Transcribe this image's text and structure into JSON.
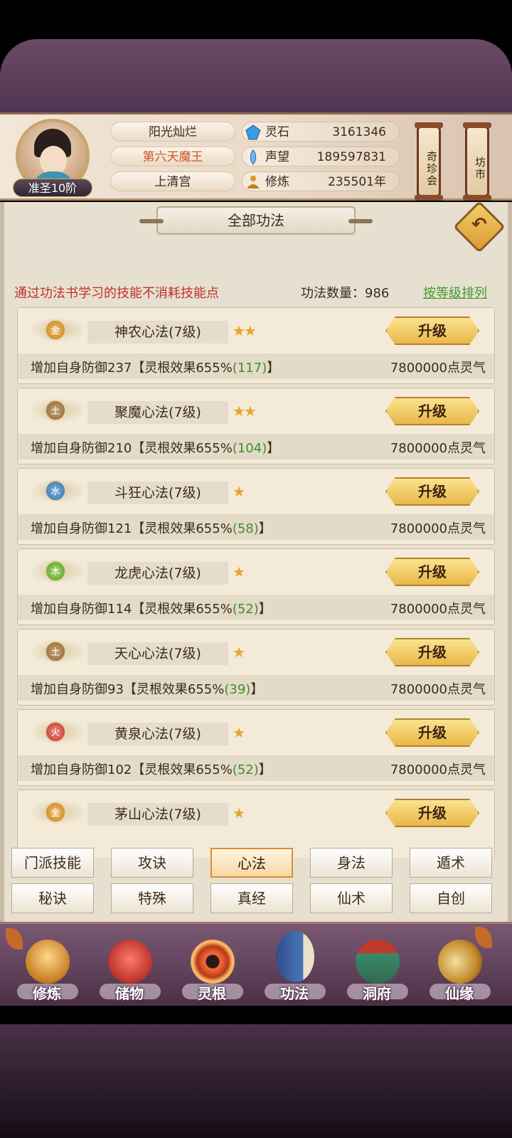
{
  "header": {
    "rank_badge": "准圣10阶",
    "player_name": "阳光灿烂",
    "title": "第六天魔王",
    "sect": "上清宫",
    "resources": [
      {
        "icon": "spirit-stone-icon",
        "label": "灵石",
        "value": "3161346"
      },
      {
        "icon": "prestige-icon",
        "label": "声望",
        "value": "189597831"
      },
      {
        "icon": "cultivation-icon",
        "label": "修炼",
        "value": "235501年"
      }
    ],
    "scroll_buttons": [
      "奇珍会",
      "坊市"
    ]
  },
  "panel": {
    "title": "全部功法",
    "hint": "通过功法书学习的技能不消耗技能点",
    "count_label": "功法数量：986",
    "sort_label": "按等级排列"
  },
  "skills": [
    {
      "element": "金",
      "element_class": "e-gold",
      "name": "神农心法(7级)",
      "stars": "★★",
      "upgrade": "升级",
      "desc_prefix": "增加自身防御237【灵根效果655%",
      "desc_bonus": "(117)",
      "desc_suffix": "】",
      "cost": "7800000点灵气"
    },
    {
      "element": "土",
      "element_class": "e-earth",
      "name": "聚魔心法(7级)",
      "stars": "★★",
      "upgrade": "升级",
      "desc_prefix": "增加自身防御210【灵根效果655%",
      "desc_bonus": "(104)",
      "desc_suffix": "】",
      "cost": "7800000点灵气"
    },
    {
      "element": "水",
      "element_class": "e-water",
      "name": "斗狂心法(7级)",
      "stars": "★",
      "upgrade": "升级",
      "desc_prefix": "增加自身防御121【灵根效果655%",
      "desc_bonus": "(58)",
      "desc_suffix": "】",
      "cost": "7800000点灵气"
    },
    {
      "element": "木",
      "element_class": "e-wood",
      "name": "龙虎心法(7级)",
      "stars": "★",
      "upgrade": "升级",
      "desc_prefix": "增加自身防御114【灵根效果655%",
      "desc_bonus": "(52)",
      "desc_suffix": "】",
      "cost": "7800000点灵气"
    },
    {
      "element": "土",
      "element_class": "e-earth",
      "name": "天心心法(7级)",
      "stars": "★",
      "upgrade": "升级",
      "desc_prefix": "增加自身防御93【灵根效果655%",
      "desc_bonus": "(39)",
      "desc_suffix": "】",
      "cost": "7800000点灵气"
    },
    {
      "element": "火",
      "element_class": "e-fire",
      "name": "黄泉心法(7级)",
      "stars": "★",
      "upgrade": "升级",
      "desc_prefix": "增加自身防御102【灵根效果655%",
      "desc_bonus": "(52)",
      "desc_suffix": "】",
      "cost": "7800000点灵气"
    },
    {
      "element": "金",
      "element_class": "e-gold",
      "name": "茅山心法(7级)",
      "stars": "★",
      "upgrade": "升级",
      "desc_prefix": "",
      "desc_bonus": "",
      "desc_suffix": "",
      "cost": ""
    }
  ],
  "tabs": [
    {
      "label": "门派技能",
      "active": false
    },
    {
      "label": "攻诀",
      "active": false
    },
    {
      "label": "心法",
      "active": true
    },
    {
      "label": "身法",
      "active": false
    },
    {
      "label": "遁术",
      "active": false
    },
    {
      "label": "秘诀",
      "active": false
    },
    {
      "label": "特殊",
      "active": false
    },
    {
      "label": "真经",
      "active": false
    },
    {
      "label": "仙术",
      "active": false
    },
    {
      "label": "自创",
      "active": false
    }
  ],
  "nav": [
    {
      "label": "修炼",
      "icon": "cultivate-icon",
      "cls": "n-cult"
    },
    {
      "label": "储物",
      "icon": "storage-bag-icon",
      "cls": "n-bag"
    },
    {
      "label": "灵根",
      "icon": "spirit-root-icon",
      "cls": "n-root"
    },
    {
      "label": "功法",
      "icon": "skill-book-icon",
      "cls": "n-book"
    },
    {
      "label": "洞府",
      "icon": "cave-house-icon",
      "cls": "n-house"
    },
    {
      "label": "仙缘",
      "icon": "destiny-gourd-icon",
      "cls": "n-fate"
    }
  ],
  "colors": {
    "hint_red": "#c0302a",
    "sort_green": "#3f9b2e",
    "title_orange": "#d2542a",
    "button_gold": "#e9b748"
  }
}
